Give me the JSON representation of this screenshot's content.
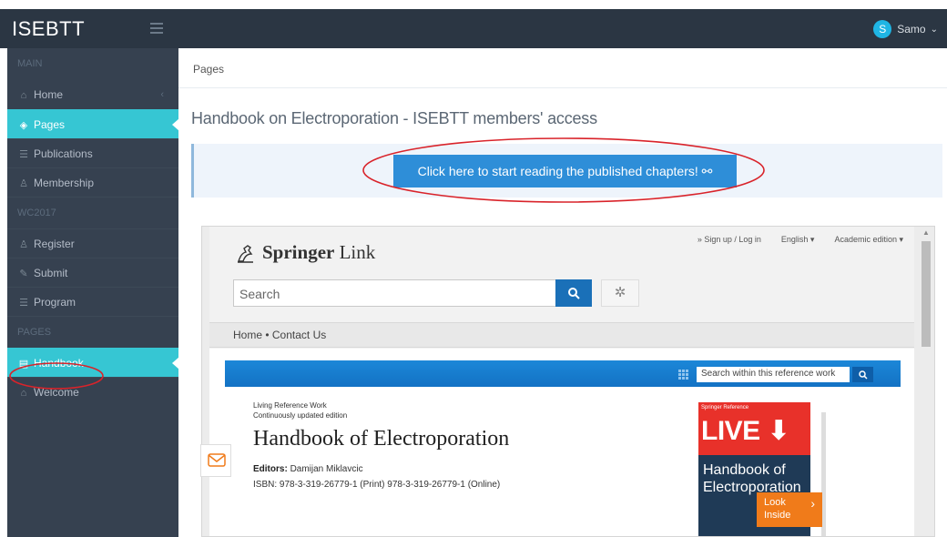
{
  "topbar": {
    "brand": "ISEBTT",
    "user": {
      "initial": "S",
      "name": "Samo"
    }
  },
  "sidebar": {
    "sections": [
      {
        "label": "MAIN"
      },
      {
        "label": "WC2017"
      },
      {
        "label": "PAGES"
      }
    ],
    "items": [
      {
        "label": "Home",
        "icon": "home-icon"
      },
      {
        "label": "Pages",
        "icon": "layers-icon"
      },
      {
        "label": "Publications",
        "icon": "list-icon"
      },
      {
        "label": "Membership",
        "icon": "users-icon"
      },
      {
        "label": "Register",
        "icon": "user-icon"
      },
      {
        "label": "Submit",
        "icon": "edit-icon"
      },
      {
        "label": "Program",
        "icon": "list-icon"
      },
      {
        "label": "Handbook",
        "icon": "book-icon"
      },
      {
        "label": "Welcome",
        "icon": "home-icon"
      }
    ]
  },
  "breadcrumb": "Pages",
  "page_title": "Handbook on Electroporation - ISEBTT members' access",
  "read_button": "Click here to start reading the published chapters! ⚯",
  "annotation_color": "#d9232a",
  "embedded": {
    "logo_bold": "Springer",
    "logo_light": "Link",
    "top_links": [
      "» Sign up / Log in",
      "English ▾",
      "Academic edition ▾"
    ],
    "search_placeholder": "Search",
    "nav": "Home  •  Contact Us",
    "within_placeholder": "Search within this reference work",
    "work_type": "Living Reference Work",
    "edition": "Continuously updated edition",
    "book_title": "Handbook of Electroporation",
    "editors_label": "Editors:",
    "editors_name": "Damijan Miklavcic",
    "isbn": "ISBN: 978-3-319-26779-1 (Print) 978-3-319-26779-1 (Online)",
    "cover": {
      "series": "Springer Reference",
      "live": "LIVE",
      "title_line1": "Handbook of",
      "title_line2": "Electroporation",
      "look_line1": "Look",
      "look_line2": "Inside"
    }
  },
  "colors": {
    "topbar": "#2b3643",
    "sidebar": "#364150",
    "active": "#36c6d3",
    "button": "#2e8ed8",
    "springer_blue": "#1372c4",
    "cover_red": "#e8312a",
    "look_orange": "#f07b1a"
  }
}
